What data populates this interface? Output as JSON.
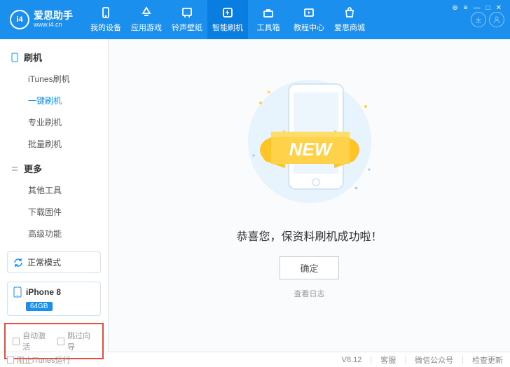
{
  "app": {
    "name": "爱思助手",
    "url": "www.i4.cn",
    "logo_badge": "i4",
    "version": "V8.12"
  },
  "nav": [
    {
      "label": "我的设备",
      "icon": "phone"
    },
    {
      "label": "应用游戏",
      "icon": "apps"
    },
    {
      "label": "铃声壁纸",
      "icon": "wallpaper"
    },
    {
      "label": "智能刷机",
      "icon": "flash",
      "active": true
    },
    {
      "label": "工具箱",
      "icon": "toolbox"
    },
    {
      "label": "教程中心",
      "icon": "tutorial"
    },
    {
      "label": "爱思商城",
      "icon": "shop"
    }
  ],
  "sidebar": {
    "sections": [
      {
        "title": "刷机",
        "items": [
          "iTunes刷机",
          "一键刷机",
          "专业刷机",
          "批量刷机"
        ],
        "activeIndex": 1
      },
      {
        "title": "更多",
        "items": [
          "其他工具",
          "下载固件",
          "高级功能"
        ]
      }
    ],
    "mode": "正常模式",
    "device": {
      "name": "iPhone 8",
      "capacity": "64GB"
    },
    "checks": {
      "auto_activate": "自动激活",
      "skip_guide": "跳过向导"
    }
  },
  "main": {
    "message": "恭喜您，保资料刷机成功啦！",
    "ok": "确定",
    "view_log": "查看日志",
    "illus_text": "NEW"
  },
  "footer": {
    "block_itunes": "阻止iTunes运行",
    "items": [
      "客服",
      "微信公众号",
      "检查更新"
    ]
  }
}
